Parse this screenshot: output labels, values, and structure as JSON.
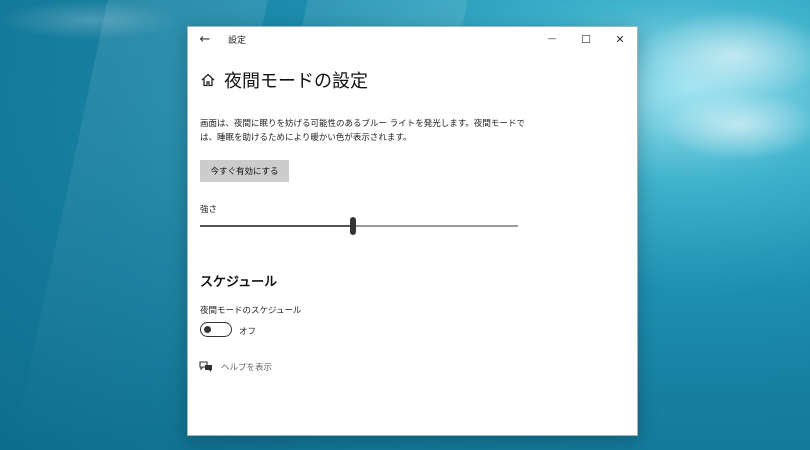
{
  "window": {
    "title": "設定",
    "back_glyph": "←",
    "minimize_glyph": "—",
    "maximize_glyph": "☐",
    "close_glyph": "✕"
  },
  "page": {
    "title": "夜間モードの設定",
    "description": "画面は、夜間に眠りを妨げる可能性のあるブルー ライトを発光します。夜間モードでは、睡眠を助けるためにより暖かい色が表示されます。",
    "enable_button": "今すぐ有効にする",
    "strength_label": "強さ",
    "strength_value": 0.48
  },
  "schedule": {
    "heading": "スケジュール",
    "label": "夜間モードのスケジュール",
    "toggle_on": false,
    "toggle_state": "オフ"
  },
  "help": {
    "link": "ヘルプを表示"
  },
  "icons": {
    "back": "back-arrow-icon",
    "home": "home-icon",
    "help": "chat-help-icon",
    "minimize": "minimize-icon",
    "maximize": "maximize-icon",
    "close": "close-icon"
  }
}
